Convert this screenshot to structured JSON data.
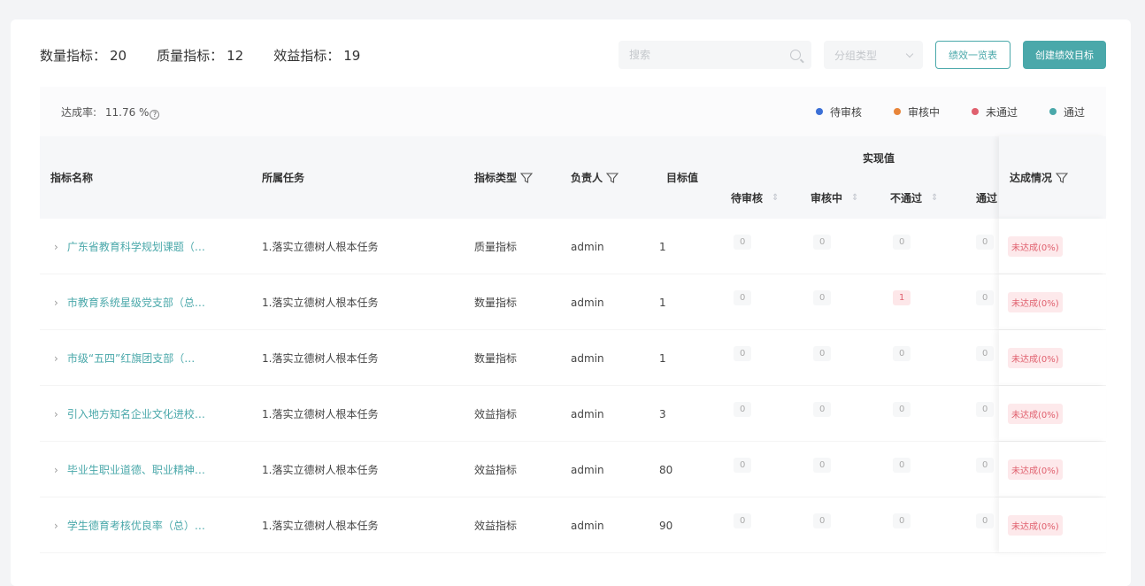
{
  "stats": [
    {
      "label": "数量指标：",
      "value": "20"
    },
    {
      "label": "质量指标：",
      "value": "12"
    },
    {
      "label": "效益指标：",
      "value": "19"
    }
  ],
  "toolbar": {
    "search_placeholder": "搜索",
    "select_placeholder": "分组类型",
    "list_button": "绩效一览表",
    "create_button": "创建绩效目标"
  },
  "rate": {
    "label": "达成率:",
    "value": "11.76 %",
    "help_icon": "question-icon"
  },
  "legend": [
    {
      "label": "待审核",
      "color": "#3b6fd6"
    },
    {
      "label": "审核中",
      "color": "#e8853a"
    },
    {
      "label": "未通过",
      "color": "#e0606e"
    },
    {
      "label": "通过",
      "color": "#4aa8aa"
    }
  ],
  "columns": {
    "name": "指标名称",
    "task": "所属任务",
    "type": "指标类型",
    "owner": "负责人",
    "target": "目标值",
    "actual_group": "实现值",
    "pending": "待审核",
    "reviewing": "审核中",
    "rejected": "不通过",
    "passed": "通过",
    "status": "达成情况"
  },
  "rows": [
    {
      "name": "广东省教育科学规划课题（…",
      "task": "1.落实立德树人根本任务",
      "type": "质量指标",
      "owner": "admin",
      "target": "1",
      "pending": "0",
      "reviewing": "0",
      "rejected": "0",
      "passed": "0",
      "status": "未达成(0%)"
    },
    {
      "name": "市教育系统星级党支部（总…",
      "task": "1.落实立德树人根本任务",
      "type": "数量指标",
      "owner": "admin",
      "target": "1",
      "pending": "0",
      "reviewing": "0",
      "rejected": "1",
      "passed": "0",
      "status": "未达成(0%)"
    },
    {
      "name": "市级“五四”红旗团支部（…",
      "task": "1.落实立德树人根本任务",
      "type": "数量指标",
      "owner": "admin",
      "target": "1",
      "pending": "0",
      "reviewing": "0",
      "rejected": "0",
      "passed": "0",
      "status": "未达成(0%)"
    },
    {
      "name": "引入地方知名企业文化进校…",
      "task": "1.落实立德树人根本任务",
      "type": "效益指标",
      "owner": "admin",
      "target": "3",
      "pending": "0",
      "reviewing": "0",
      "rejected": "0",
      "passed": "0",
      "status": "未达成(0%)"
    },
    {
      "name": "毕业生职业道德、职业精神…",
      "task": "1.落实立德树人根本任务",
      "type": "效益指标",
      "owner": "admin",
      "target": "80",
      "pending": "0",
      "reviewing": "0",
      "rejected": "0",
      "passed": "0",
      "status": "未达成(0%)"
    },
    {
      "name": "学生德育考核优良率（总）…",
      "task": "1.落实立德树人根本任务",
      "type": "效益指标",
      "owner": "admin",
      "target": "90",
      "pending": "0",
      "reviewing": "0",
      "rejected": "0",
      "passed": "0",
      "status": "未达成(0%)"
    }
  ]
}
